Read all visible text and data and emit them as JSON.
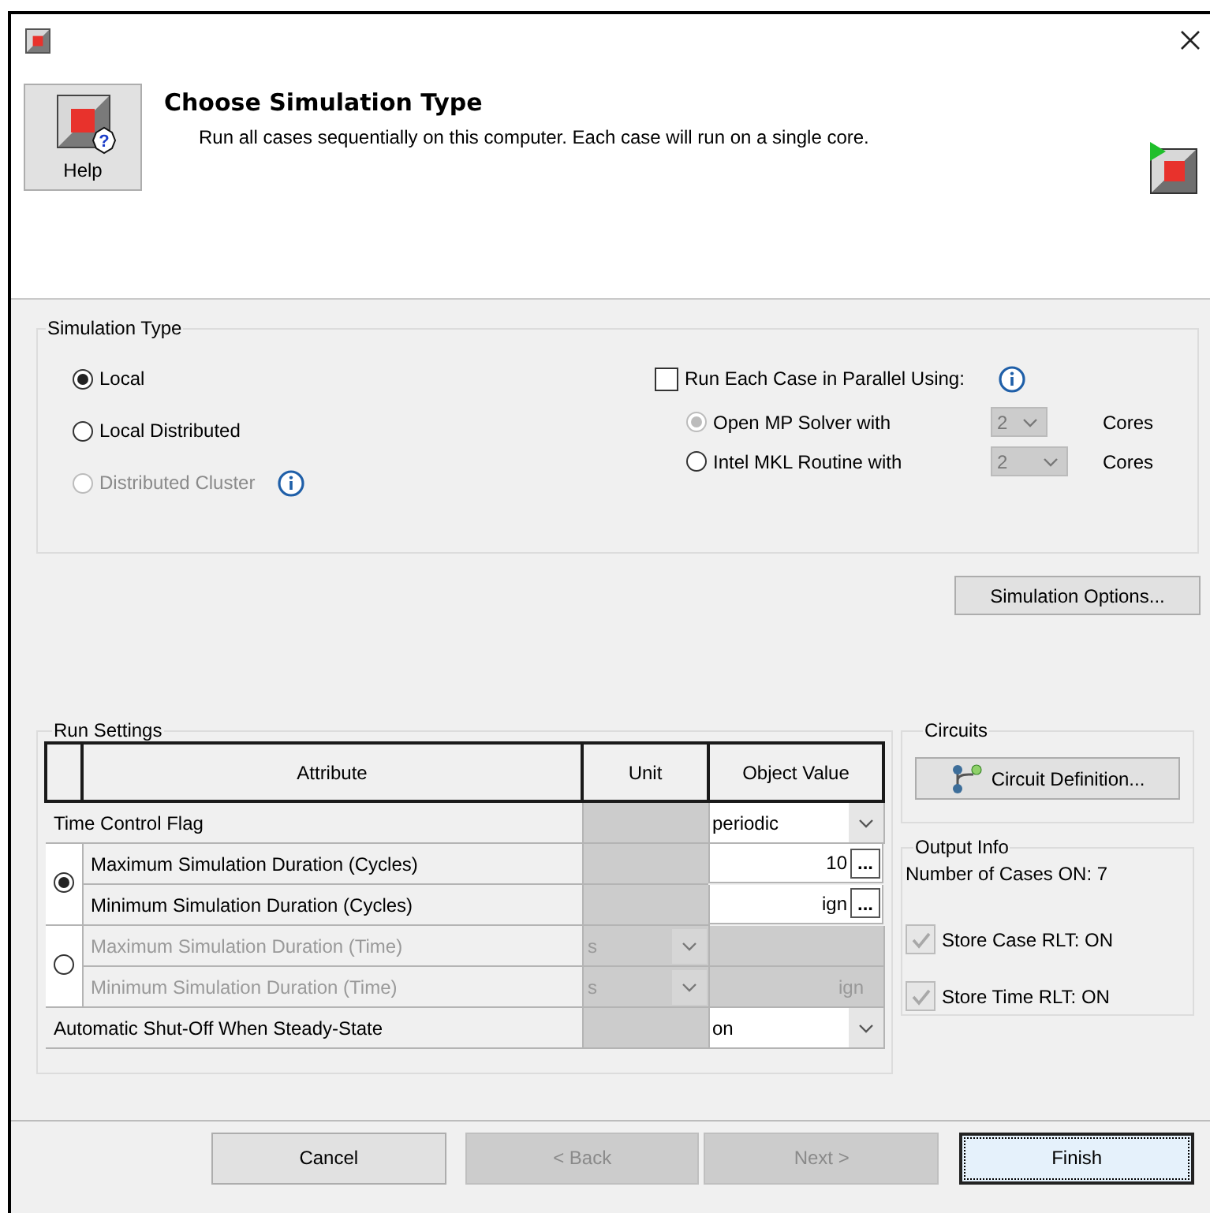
{
  "header": {
    "help_button": "Help",
    "help_icon_symbol": "?",
    "title": "Choose Simulation Type",
    "description": "Run all cases sequentially on this computer. Each case will run on a single core."
  },
  "simulation_type": {
    "title": "Simulation Type",
    "modes": [
      {
        "label": "Local",
        "selected": true,
        "disabled": false,
        "info": false
      },
      {
        "label": "Local Distributed",
        "selected": false,
        "disabled": false,
        "info": false
      },
      {
        "label": "Distributed Cluster",
        "selected": false,
        "disabled": true,
        "info": true
      }
    ],
    "parallel": {
      "label": "Run Each Case in Parallel Using:",
      "checked": false,
      "info": true,
      "options": [
        {
          "label": "Open MP Solver with",
          "selected": true,
          "disabled": true,
          "cores": "2",
          "unit": "Cores"
        },
        {
          "label": "Intel MKL Routine with",
          "selected": false,
          "disabled": false,
          "cores": "2",
          "unit": "Cores"
        }
      ]
    }
  },
  "simulation_options_button": "Simulation Options...",
  "run_settings": {
    "title": "Run Settings",
    "columns": [
      "Attribute",
      "Unit",
      "Object Value"
    ],
    "rows": [
      {
        "kind": "dropdown",
        "attribute": "Time Control Flag",
        "value": "periodic"
      },
      {
        "kind": "radio_group",
        "selected": true,
        "disabled": false,
        "items": [
          {
            "attribute": "Maximum Simulation Duration (Cycles)",
            "value": "10",
            "kind": "browse",
            "button": "..."
          },
          {
            "attribute": "Minimum Simulation Duration (Cycles)",
            "value": "ign",
            "kind": "browse",
            "button": "..."
          }
        ]
      },
      {
        "kind": "radio_group",
        "selected": false,
        "disabled": true,
        "items": [
          {
            "attribute": "Maximum Simulation Duration (Time)",
            "unit": "s",
            "kind": "text"
          },
          {
            "attribute": "Minimum Simulation Duration (Time)",
            "unit": "s",
            "value": "ign",
            "kind": "text"
          }
        ]
      },
      {
        "kind": "dropdown",
        "attribute": "Automatic Shut-Off When Steady-State",
        "value": "on"
      }
    ]
  },
  "circuits": {
    "title": "Circuits",
    "button": "Circuit Definition..."
  },
  "output_info": {
    "title": "Output Info",
    "cases": "Number of Cases ON: 7",
    "options": [
      {
        "label": "Store Case RLT: ON",
        "checked": true,
        "disabled": true
      },
      {
        "label": "Store Time RLT: ON",
        "checked": true,
        "disabled": true
      }
    ]
  },
  "buttons": [
    {
      "label": "Cancel",
      "disabled": false,
      "default": false
    },
    {
      "label": "< Back",
      "disabled": true,
      "default": false
    },
    {
      "label": "Next >",
      "disabled": true,
      "default": false
    },
    {
      "label": "Finish",
      "disabled": false,
      "default": true
    }
  ]
}
